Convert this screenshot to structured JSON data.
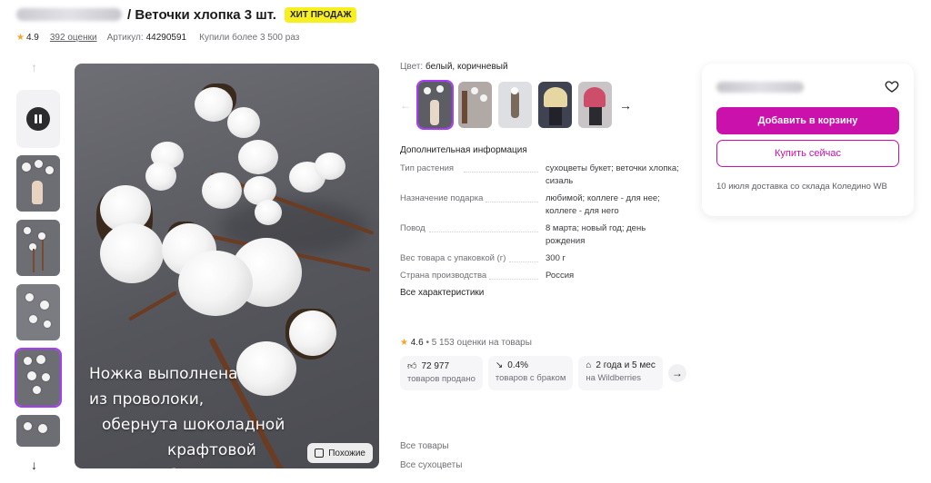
{
  "product": {
    "title": "/ Веточки хлопка 3 шт.",
    "badge": "ХИТ ПРОДАЖ",
    "rating": "4.9",
    "reviews": "392 оценки",
    "article_label": "Артикул:",
    "article_value": "44290591",
    "bought": "Купили более 3 500 раз"
  },
  "media": {
    "caption_lines": [
      "Ножка выполнена",
      "из проволоки,",
      "обернута шоколадной",
      "крафтовой бумагой"
    ],
    "similar_label": "Похожие"
  },
  "options": {
    "color_label": "Цвет:",
    "color_value": "белый, коричневый"
  },
  "details": {
    "title": "Дополнительная информация",
    "attributes": [
      {
        "key": "Тип растения",
        "value": "сухоцветы букет; веточки хлопка; сизаль"
      },
      {
        "key": "Назначение подарка",
        "value": "любимой; коллеге - для нее; коллеге - для него"
      },
      {
        "key": "Повод",
        "value": "8 марта; новый год; день рождения"
      },
      {
        "key": "Вес товара с упаковкой (г)",
        "value": "300 г"
      },
      {
        "key": "Страна производства",
        "value": "Россия"
      }
    ],
    "all_link": "Все характеристики"
  },
  "seller_stats": {
    "rating": "4.6",
    "rating_text": "• 5 153 оценки на товары",
    "items": [
      {
        "icon": "thumbs-up-icon",
        "value": "72 977",
        "label": "товаров продано"
      },
      {
        "icon": "trend-down-icon",
        "value": "0.4%",
        "label": "товаров с браком"
      },
      {
        "icon": "store-icon",
        "value": "2 года и 5 мес",
        "label": "на Wildberries"
      }
    ]
  },
  "links": {
    "all_items": "Все товары",
    "all_dried": "Все сухоцветы"
  },
  "buy": {
    "add_to_cart": "Добавить в корзину",
    "buy_now": "Купить сейчас",
    "delivery": "10 июля доставка со склада Коледино WB"
  },
  "colors": {
    "accent": "#cb11ab",
    "selection": "#a73afd",
    "badge": "#f7ef1f",
    "star": "#f5a623"
  }
}
